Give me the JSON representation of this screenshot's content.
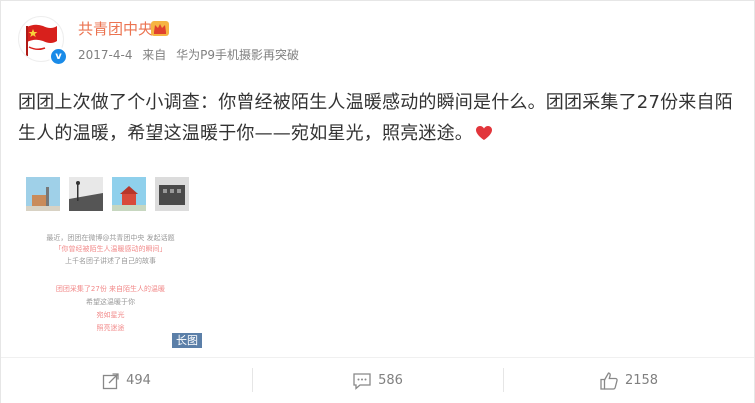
{
  "post": {
    "author": "共青团中央",
    "date": "2017-4-4",
    "source_prefix": "来自",
    "source": "华为P9手机摄影再突破",
    "text": "团团上次做了个小调查：你曾经被陌生人温暖感动的瞬间是什么。团团采集了27份来自陌生人的温暖，希望这温暖于你——宛如星光，照亮迷途。"
  },
  "long_image": {
    "lines": [
      "最近，团团在微博@共青团中央 发起话题",
      "「你曾经被陌生人温暖感动的瞬间」",
      "上千名团子讲述了自己的故事",
      "团团采集了27份 来自陌生人的温暖",
      "希望这温暖于你",
      "宛如星光",
      "照亮迷途"
    ],
    "tag": "长图"
  },
  "actions": {
    "forward_count": "494",
    "comment_count": "586",
    "like_count": "2158"
  },
  "colors": {
    "name": "#eb7350",
    "verified": "#1a8be8",
    "tag_bg": "#5b7fa8",
    "heart": "#e2353b"
  }
}
